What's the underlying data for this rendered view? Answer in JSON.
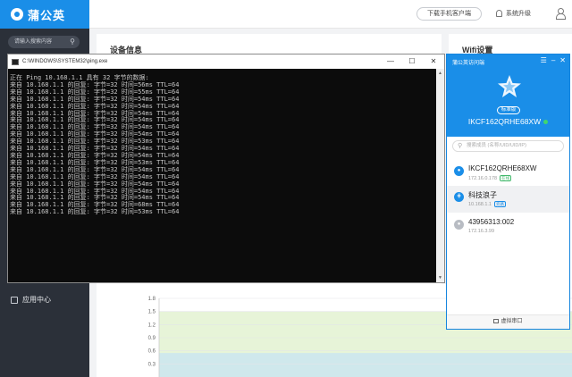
{
  "app": {
    "brand": "蒲公英",
    "search_placeholder": "请输入搜索内容",
    "menu_app_center": "应用中心",
    "download_client": "下载手机客户端",
    "system_upgrade": "系统升级",
    "panel_device_info": "设备信息",
    "panel_wifi": "Wifi设置"
  },
  "chart_data": {
    "type": "area",
    "y_ticks": [
      "1.8",
      "1.5",
      "1.2",
      "0.9",
      "0.6",
      "0.3"
    ],
    "ylim": [
      0,
      1.8
    ],
    "series": [
      {
        "color": "#e7f4d8",
        "values": [
          1.5,
          1.5
        ]
      },
      {
        "color": "#cfe8ec",
        "values": [
          0.55,
          0.55
        ]
      }
    ]
  },
  "cmd": {
    "title": "C:\\WINDOWS\\SYSTEM32\\ping.exe",
    "lines": [
      "正在 Ping 10.168.1.1 具有 32 字节的数据:",
      "来自 10.168.1.1 的回复: 字节=32 时间=56ms TTL=64",
      "来自 10.168.1.1 的回复: 字节=32 时间=55ms TTL=64",
      "来自 10.168.1.1 的回复: 字节=32 时间=54ms TTL=64",
      "来自 10.168.1.1 的回复: 字节=32 时间=54ms TTL=64",
      "来自 10.168.1.1 的回复: 字节=32 时间=54ms TTL=64",
      "来自 10.168.1.1 的回复: 字节=32 时间=54ms TTL=64",
      "来自 10.168.1.1 的回复: 字节=32 时间=54ms TTL=64",
      "来自 10.168.1.1 的回复: 字节=32 时间=54ms TTL=64",
      "来自 10.168.1.1 的回复: 字节=32 时间=53ms TTL=64",
      "来自 10.168.1.1 的回复: 字节=32 时间=54ms TTL=64",
      "来自 10.168.1.1 的回复: 字节=32 时间=54ms TTL=64",
      "来自 10.168.1.1 的回复: 字节=32 时间=53ms TTL=64",
      "来自 10.168.1.1 的回复: 字节=32 时间=54ms TTL=64",
      "来自 10.168.1.1 的回复: 字节=32 时间=54ms TTL=64",
      "来自 10.168.1.1 的回复: 字节=32 时间=54ms TTL=64",
      "来自 10.168.1.1 的回复: 字节=32 时间=54ms TTL=64",
      "来自 10.168.1.1 的回复: 字节=32 时间=54ms TTL=64",
      "来自 10.168.1.1 的回复: 字节=32 时间=68ms TTL=64",
      "来自 10.168.1.1 的回复: 字节=32 时间=53ms TTL=64"
    ]
  },
  "access": {
    "title": "蒲公英访问端",
    "badge": "标准版",
    "device_id": "IKCF162QRHE68XW",
    "search_placeholder": "搜索成员 (名称/UID/UID/IP)",
    "devices": [
      {
        "name": "IKCF162QRHE68XW",
        "ip": "172.16.0.178",
        "tag": "在线"
      },
      {
        "name": "科技浪子",
        "ip": "10.168.1.1",
        "tag": "旁路"
      },
      {
        "name": "43956313:002",
        "ip": "172.16.3.99",
        "tag": ""
      }
    ],
    "footer": "虚拟串口"
  }
}
